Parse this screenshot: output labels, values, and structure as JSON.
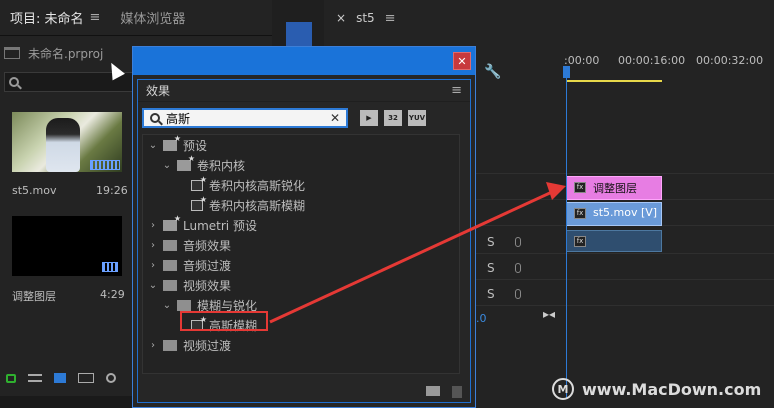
{
  "project_panel": {
    "tab_project": "项目: 未命名",
    "tab_media_browser": "媒体浏览器",
    "file_name": "未命名.prproj",
    "clips": [
      {
        "name": "st5.mov",
        "duration": "19:26"
      },
      {
        "name": "调整图层",
        "duration": "4:29"
      }
    ]
  },
  "timeline": {
    "tab": "st5",
    "times": [
      ":00:00",
      "00:00:16:00",
      "00:00:32:00"
    ],
    "clips": {
      "adjustment": "调整图层",
      "video": "st5.mov [V]"
    },
    "track_letters": [
      "S",
      "S",
      "S"
    ],
    "blue_value": ".0"
  },
  "effects_dialog": {
    "title": "效果",
    "search_value": "高斯",
    "filter_buttons": [
      "32",
      "YUV"
    ],
    "tree": [
      {
        "label": "预设",
        "level": 0,
        "expanded": true,
        "icon": "preset-folder"
      },
      {
        "label": "卷积内核",
        "level": 1,
        "expanded": true,
        "icon": "preset-folder"
      },
      {
        "label": "卷积内核高斯锐化",
        "level": 2,
        "icon": "preset-effect"
      },
      {
        "label": "卷积内核高斯模糊",
        "level": 2,
        "icon": "preset-effect"
      },
      {
        "label": "Lumetri 预设",
        "level": 0,
        "expanded": false,
        "icon": "preset-folder"
      },
      {
        "label": "音频效果",
        "level": 0,
        "expanded": false,
        "icon": "folder"
      },
      {
        "label": "音频过渡",
        "level": 0,
        "expanded": false,
        "icon": "folder"
      },
      {
        "label": "视频效果",
        "level": 0,
        "expanded": true,
        "icon": "folder"
      },
      {
        "label": "模糊与锐化",
        "level": 1,
        "expanded": true,
        "icon": "folder"
      },
      {
        "label": "高斯模糊",
        "level": 2,
        "icon": "effect"
      },
      {
        "label": "视频过渡",
        "level": 0,
        "expanded": false,
        "icon": "folder"
      }
    ]
  },
  "watermark": "www.MacDown.com"
}
